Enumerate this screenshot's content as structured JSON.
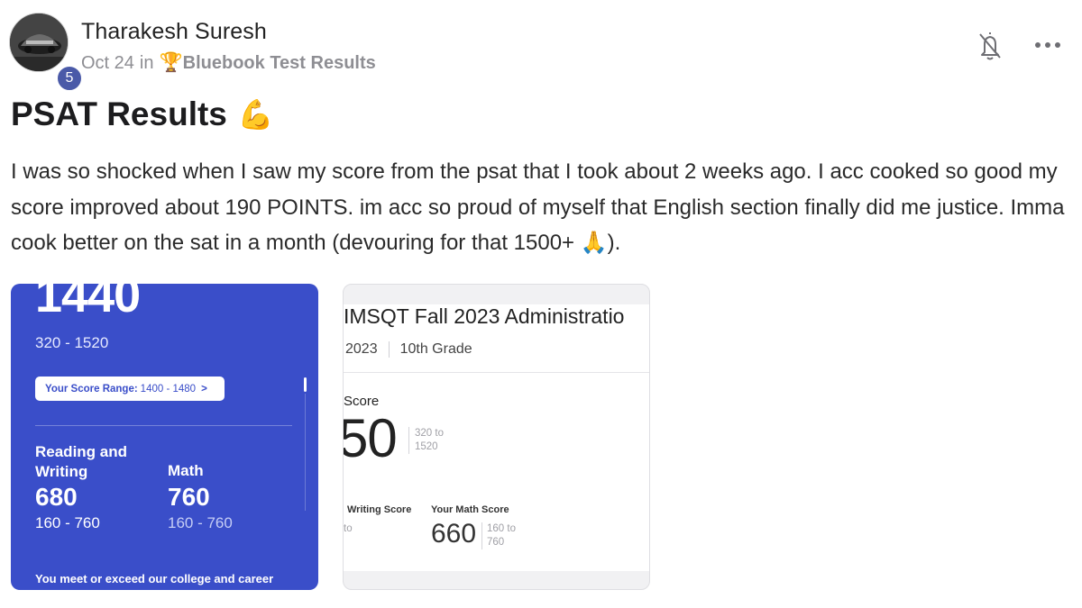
{
  "author": {
    "name": "Tharakesh Suresh",
    "level": "5"
  },
  "meta": {
    "date": "Oct 24",
    "in_text": "in",
    "trophy": "🏆",
    "group": "Bluebook Test Results"
  },
  "post": {
    "title": "PSAT Results",
    "title_emoji": "💪",
    "body": "I was so shocked when I saw my score from the psat that I took about 2 weeks ago. I acc cooked so good my score improved about 190 POINTS. im acc so proud of myself that English section finally did me justice. Imma cook better on the sat in a month (devouring for that 1500+ 🙏)."
  },
  "image1": {
    "total_score": "1440",
    "total_range": "320 - 1520",
    "score_range_label": "Your Score Range:",
    "score_range_value": "1400 - 1480",
    "score_range_chevron": ">",
    "rw_label": "Reading and Writing",
    "rw_score": "680",
    "rw_range": "160 - 760",
    "math_label": "Math",
    "math_score": "760",
    "math_range": "160 - 760",
    "footer": "You meet or exceed our college and career"
  },
  "image2": {
    "heading": "IMSQT Fall 2023 Administratio",
    "year": "2023",
    "grade": "10th Grade",
    "score_label": "Score",
    "total_partial": "50",
    "total_range_a": "320 to",
    "total_range_b": "1520",
    "rw_label": "Writing Score",
    "rw_to": "to",
    "math_label": "Your Math Score",
    "math_score": "660",
    "math_range_a": "160 to",
    "math_range_b": "760"
  },
  "icons": {
    "bell": "bell-off-icon",
    "more": "more-horizontal-icon",
    "accent": "#3a4ec9",
    "badge": "#4a5aa8"
  }
}
